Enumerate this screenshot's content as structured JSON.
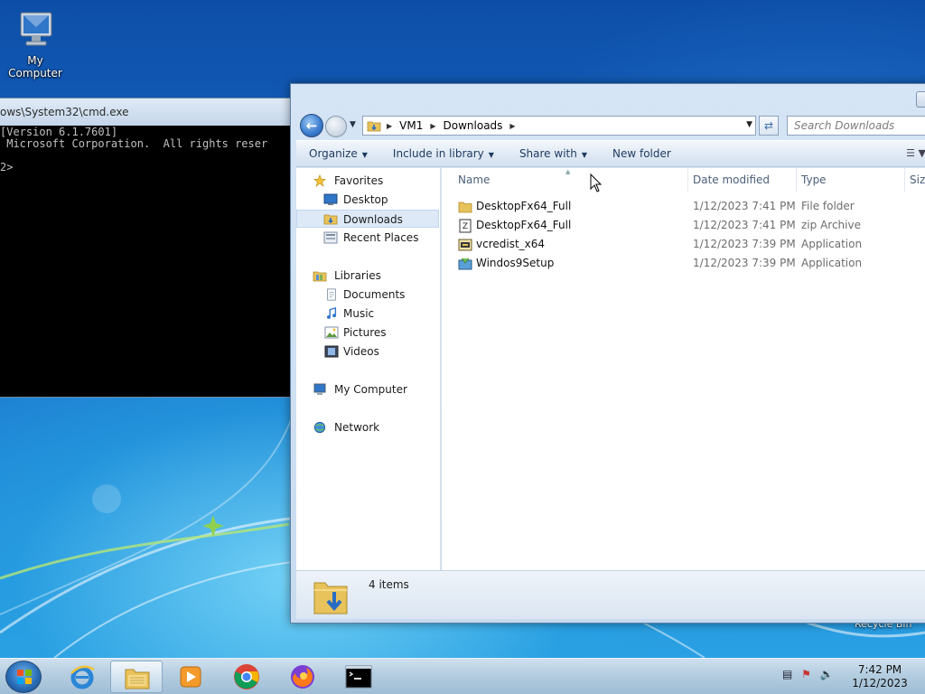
{
  "desktop": {
    "icons": [
      {
        "label": "My Computer",
        "icon": "my-computer-icon"
      }
    ],
    "recycle_bin_label": "Recycle Bin"
  },
  "cmd_window": {
    "title": "ows\\System32\\cmd.exe",
    "lines": [
      "[Version 6.1.7601]",
      " Microsoft Corporation.  All rights reser",
      "",
      "2>"
    ]
  },
  "explorer": {
    "breadcrumb": [
      "VM1",
      "Downloads"
    ],
    "search_placeholder": "Search Downloads",
    "toolbar": {
      "organize": "Organize",
      "include_in_library": "Include in library",
      "share_with": "Share with",
      "new_folder": "New folder"
    },
    "nav": {
      "favorites": "Favorites",
      "favorites_items": [
        "Desktop",
        "Downloads",
        "Recent Places"
      ],
      "libraries": "Libraries",
      "libraries_items": [
        "Documents",
        "Music",
        "Pictures",
        "Videos"
      ],
      "computer": "My Computer",
      "network": "Network",
      "selected": "Downloads"
    },
    "columns": [
      "Name",
      "Date modified",
      "Type",
      "Size"
    ],
    "files": [
      {
        "name": "DesktopFx64_Full",
        "date": "1/12/2023 7:41 PM",
        "type": "File folder",
        "icon": "folder-icon"
      },
      {
        "name": "DesktopFx64_Full",
        "date": "1/12/2023 7:41 PM",
        "type": "zip Archive",
        "icon": "zip-icon"
      },
      {
        "name": "vcredist_x64",
        "date": "1/12/2023 7:39 PM",
        "type": "Application",
        "icon": "installer-icon"
      },
      {
        "name": "Windos9Setup",
        "date": "1/12/2023 7:39 PM",
        "type": "Application",
        "icon": "setup-icon"
      }
    ],
    "item_count": "4 items"
  },
  "taskbar": {
    "apps": [
      "internet-explorer-icon",
      "file-explorer-icon",
      "media-player-icon",
      "chrome-icon",
      "firefox-icon",
      "cmd-icon"
    ],
    "active_app": "file-explorer-icon",
    "time": "7:42 PM",
    "date": "1/12/2023"
  },
  "colors": {
    "selection": "#dde9f7",
    "window_frame": "#c8dbef",
    "cmd_background": "#000000"
  }
}
